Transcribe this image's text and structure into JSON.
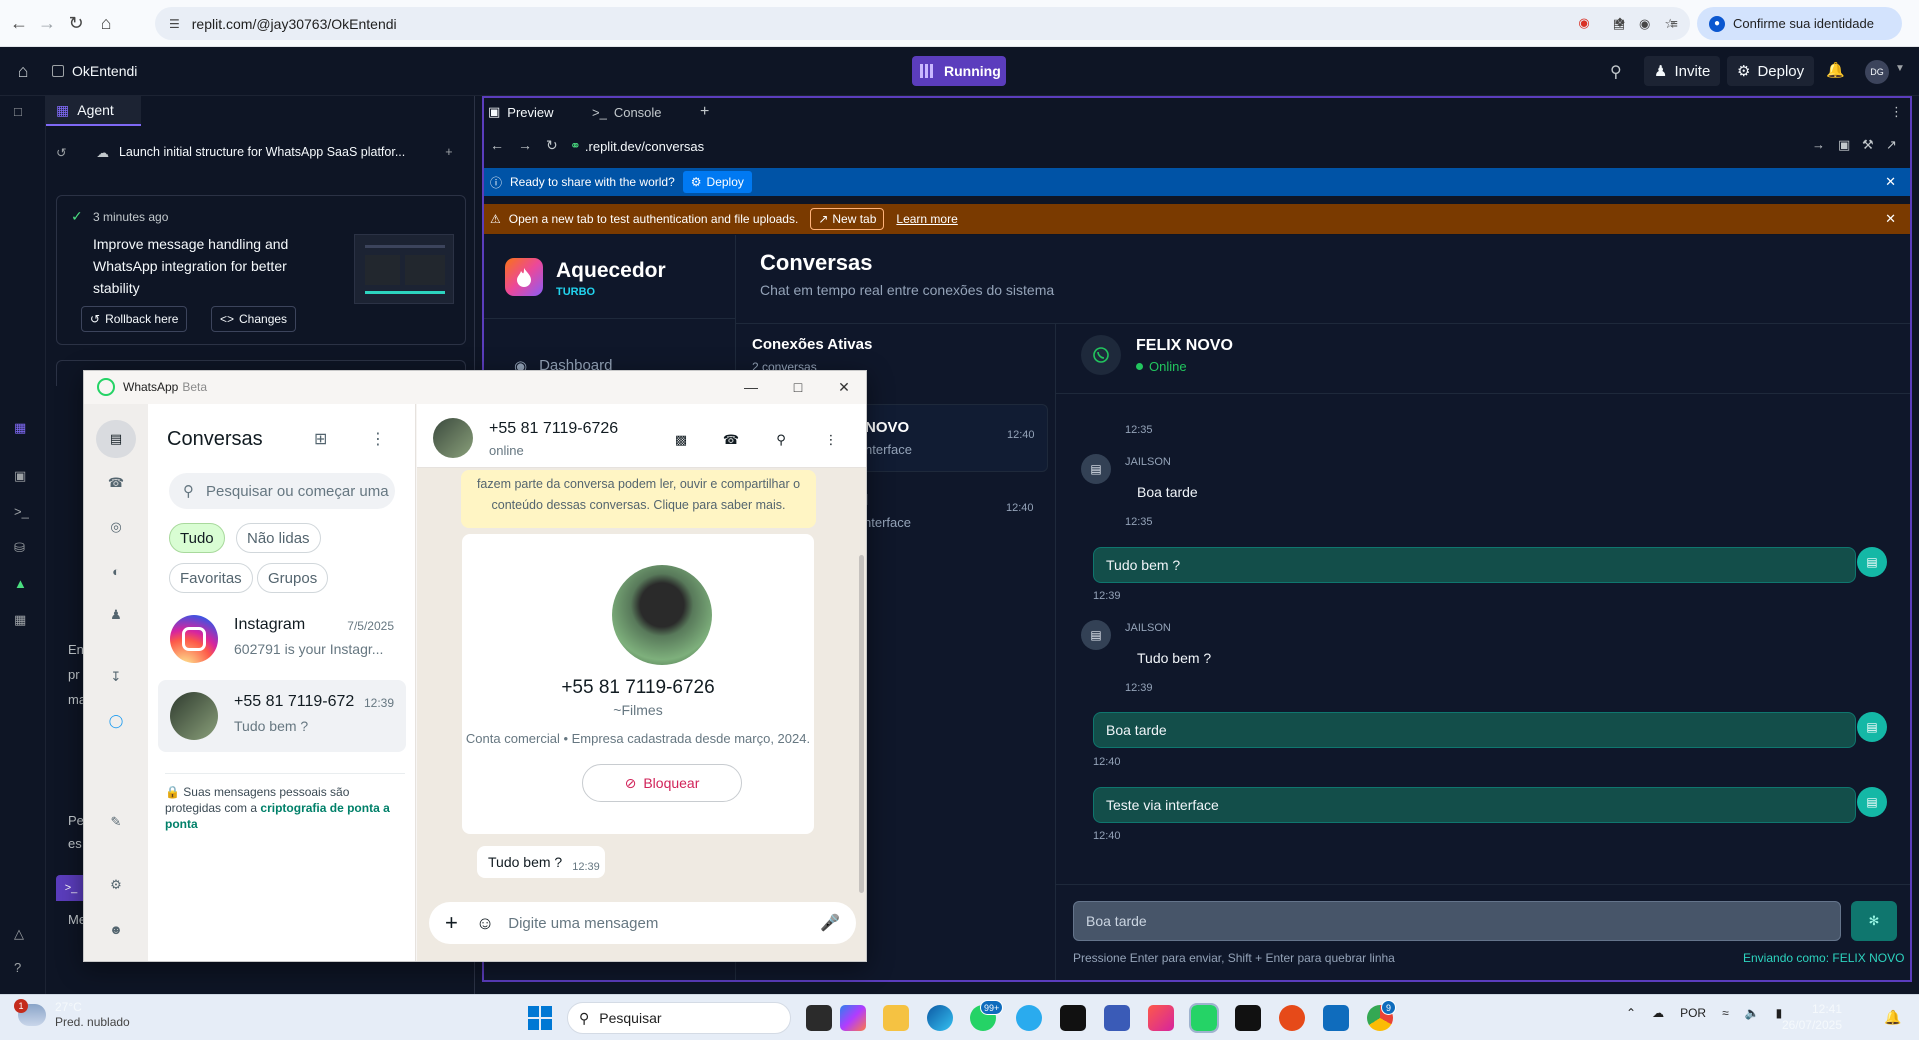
{
  "browser": {
    "url": "replit.com/@jay30763/OkEntendi",
    "identity_label": "Confirme sua identidade"
  },
  "replit": {
    "project_name": "OkEntendi",
    "run_status": "Running",
    "invite_label": "Invite",
    "deploy_label": "Deploy",
    "avatar_initials": "DG",
    "agent_tab": "Agent",
    "agent_thread": "Launch initial structure for WhatsApp SaaS platfor...",
    "checkpoint": {
      "time": "3 minutes ago",
      "title": "Improve message handling and WhatsApp integration for better stability",
      "rollback_label": "Rollback here",
      "changes_label": "Changes"
    },
    "agent_fragments": [
      "En",
      "pr",
      "ma",
      "Pe",
      "es",
      "Me"
    ],
    "preview_tab": "Preview",
    "console_tab": "Console",
    "preview_url": ".replit.dev/conversas",
    "banner_share": "Ready to share with the world?",
    "banner_share_btn": "Deploy",
    "banner_newtab": "Open a new tab to test authentication and file uploads.",
    "banner_newtab_btn": "New tab",
    "banner_learn": "Learn more"
  },
  "app": {
    "brand": "Aquecedor",
    "brand_sub": "TURBO",
    "nav_dashboard": "Dashboard",
    "page_title": "Conversas",
    "page_subtitle": "Chat em tempo real entre conexões do sistema",
    "connections_title": "Conexões Ativas",
    "connections_count": "2 conversas",
    "connections": [
      {
        "name_frag": "NOVO",
        "preview_frag": "nterface",
        "time": "12:40"
      },
      {
        "name_frag": "l",
        "preview_frag": "nterface",
        "time": "12:40"
      }
    ],
    "contact_name": "FELIX NOVO",
    "contact_status": "Online",
    "messages": [
      {
        "dir": "meta",
        "time": "12:35"
      },
      {
        "dir": "in",
        "sender": "JAILSON",
        "text": "Boa tarde",
        "time": "12:35"
      },
      {
        "dir": "out",
        "text": "Tudo bem ?",
        "time": "12:39"
      },
      {
        "dir": "in",
        "sender": "JAILSON",
        "text": "Tudo bem ?",
        "time": "12:39"
      },
      {
        "dir": "out",
        "text": "Boa tarde",
        "time": "12:40"
      },
      {
        "dir": "out",
        "text": "Teste via interface",
        "time": "12:40"
      }
    ],
    "composer_value": "Boa tarde",
    "composer_hint": "Pressione Enter para enviar, Shift + Enter para quebrar linha",
    "sending_as": "Enviando como: FELIX NOVO"
  },
  "whatsapp": {
    "title": "WhatsApp",
    "beta": "Beta",
    "list_title": "Conversas",
    "search_placeholder": "Pesquisar ou começar uma",
    "chips": [
      "Tudo",
      "Não lidas",
      "Favoritas",
      "Grupos"
    ],
    "chats": [
      {
        "name": "Instagram",
        "date": "7/5/2025",
        "preview": "602791 is your Instagr..."
      },
      {
        "name": "+55 81 7119-672",
        "date": "12:39",
        "preview": "Tudo bem ?"
      }
    ],
    "encryption_text": "Suas mensagens pessoais são protegidas com a",
    "encryption_link": "criptografia de ponta a ponta",
    "peer_phone": "+55 81 7119-6726",
    "peer_status": "online",
    "notice": "fazem parte da conversa podem ler, ouvir e compartilhar o conteúdo dessas conversas. Clique para saber mais.",
    "card_phone": "+55 81 7119-6726",
    "card_name": "~Filmes",
    "card_business": "Conta comercial • Empresa cadastrada desde março, 2024.",
    "block_label": "Bloquear",
    "last_message": "Tudo bem ?",
    "last_message_time": "12:39",
    "compose_placeholder": "Digite uma mensagem"
  },
  "taskbar": {
    "temperature": "27°C",
    "weather": "Pred. nublado",
    "weather_badge": "1",
    "search_label": "Pesquisar",
    "whatsapp_badge": "99+",
    "chrome_badge": "9",
    "language": "POR",
    "time": "12:41",
    "date": "26/07/2025"
  },
  "colors": {
    "replit_bg": "#0e1525",
    "running_purple": "#5b3dbd",
    "app_bg": "#0f172a",
    "outgoing_bubble": "#134e4a",
    "teal_accent": "#2dd4bf",
    "wa_green": "#008069"
  }
}
